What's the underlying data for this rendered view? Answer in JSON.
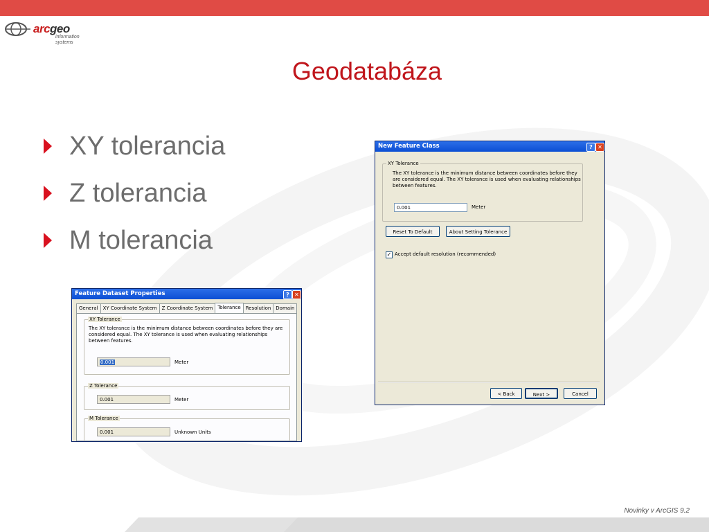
{
  "logo": {
    "brand_arc": "arc",
    "brand_geo": "geo",
    "tagline_1": "information",
    "tagline_2": "systems"
  },
  "slide": {
    "title": "Geodatabáza",
    "footer": "Novinky v ArcGIS 9.2"
  },
  "bullets": [
    "XY tolerancia",
    "Z tolerancia",
    "M tolerancia"
  ],
  "colors": {
    "accent": "#e04b45",
    "title": "#c0161c",
    "bullet_arrow": "#d9111f",
    "bullet_text": "#6d6d6d"
  },
  "dialog_fds": {
    "title": "Feature Dataset Properties",
    "help_glyph": "?",
    "close_glyph": "✕",
    "tabs": [
      "General",
      "XY Coordinate System",
      "Z Coordinate System",
      "Tolerance",
      "Resolution",
      "Domain"
    ],
    "active_tab": "Tolerance",
    "xy": {
      "legend": "XY Tolerance",
      "description": "The XY tolerance is the minimum distance between coordinates before they are considered equal. The XY tolerance is used when evaluating relationships between features.",
      "value": "0.001",
      "unit": "Meter"
    },
    "z": {
      "legend": "Z Tolerance",
      "value": "0.001",
      "unit": "Meter"
    },
    "m": {
      "legend": "M Tolerance",
      "value": "0.001",
      "unit": "Unknown Units"
    }
  },
  "dialog_nfc": {
    "title": "New Feature Class",
    "help_glyph": "?",
    "close_glyph": "✕",
    "xy": {
      "legend": "XY Tolerance",
      "description": "The XY tolerance is the minimum distance between coordinates before they are considered equal. The XY tolerance is used when evaluating relationships between features.",
      "value": "0.001",
      "unit": "Meter"
    },
    "reset_button": "Reset To Default",
    "about_button": "About Setting Tolerance",
    "checkbox_label": "Accept default resolution (recommended)",
    "checkbox_checked": true,
    "checkbox_mark": "✓",
    "back_button": "< Back",
    "next_button": "Next >",
    "cancel_button": "Cancel"
  }
}
